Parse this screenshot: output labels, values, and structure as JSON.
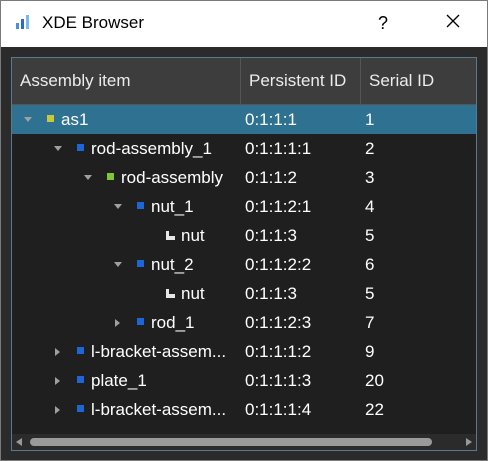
{
  "window": {
    "title": "XDE Browser",
    "help_label": "?"
  },
  "colors": {
    "selected_row": "#2e7191",
    "assembly_node": "#1e66d8",
    "part_node": "#7dc832",
    "root_node": "#c8c83c"
  },
  "tree": {
    "columns": [
      "Assembly item",
      "Persistent ID",
      "Serial ID"
    ],
    "rows": [
      {
        "name": "as1",
        "pid": "0:1:1:1",
        "sid": "1",
        "depth": 0,
        "arrow": "down",
        "icon": "root-node-icon",
        "selected": true
      },
      {
        "name": "rod-assembly_1",
        "pid": "0:1:1:1:1",
        "sid": "2",
        "depth": 1,
        "arrow": "down",
        "icon": "assembly-node-icon"
      },
      {
        "name": "rod-assembly",
        "pid": "0:1:1:2",
        "sid": "3",
        "depth": 2,
        "arrow": "down",
        "icon": "part-node-icon"
      },
      {
        "name": "nut_1",
        "pid": "0:1:1:2:1",
        "sid": "4",
        "depth": 3,
        "arrow": "down",
        "icon": "assembly-node-icon"
      },
      {
        "name": "nut",
        "pid": "0:1:1:3",
        "sid": "5",
        "depth": 4,
        "arrow": "none",
        "icon": "leaf-shape-icon"
      },
      {
        "name": "nut_2",
        "pid": "0:1:1:2:2",
        "sid": "6",
        "depth": 3,
        "arrow": "down",
        "icon": "assembly-node-icon"
      },
      {
        "name": "nut",
        "pid": "0:1:1:3",
        "sid": "5",
        "depth": 4,
        "arrow": "none",
        "icon": "leaf-shape-icon"
      },
      {
        "name": "rod_1",
        "pid": "0:1:1:2:3",
        "sid": "7",
        "depth": 3,
        "arrow": "right",
        "icon": "assembly-node-icon"
      },
      {
        "name": "l-bracket-assem...",
        "pid": "0:1:1:1:2",
        "sid": "9",
        "depth": 1,
        "arrow": "right",
        "icon": "assembly-node-icon"
      },
      {
        "name": "plate_1",
        "pid": "0:1:1:1:3",
        "sid": "20",
        "depth": 1,
        "arrow": "right",
        "icon": "assembly-node-icon"
      },
      {
        "name": "l-bracket-assem...",
        "pid": "0:1:1:1:4",
        "sid": "22",
        "depth": 1,
        "arrow": "right",
        "icon": "assembly-node-icon"
      }
    ]
  }
}
